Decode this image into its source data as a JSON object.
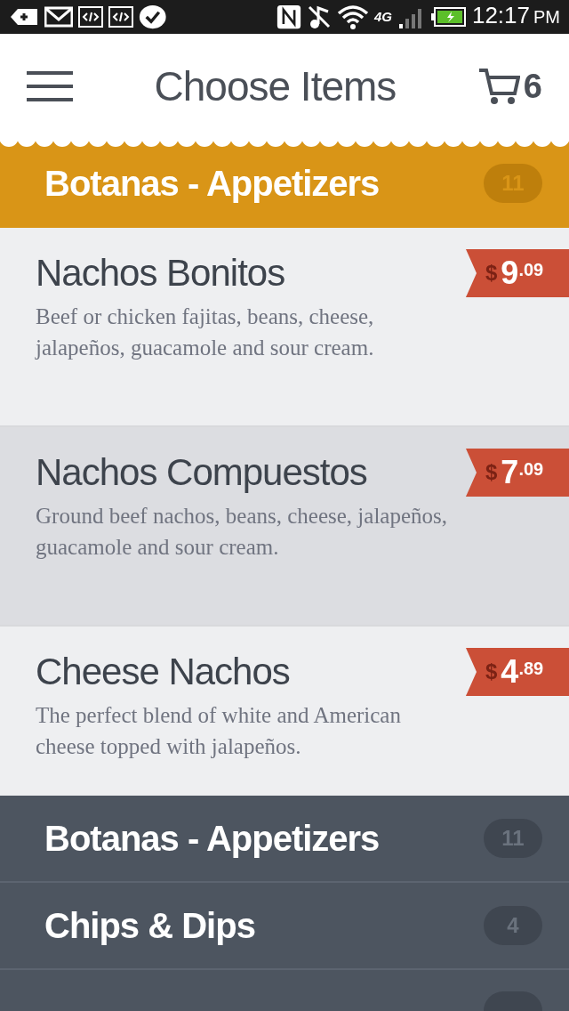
{
  "status_bar": {
    "time": "12:17",
    "ampm": "PM",
    "network": "4G"
  },
  "header": {
    "title": "Choose Items",
    "cart_count": "6"
  },
  "category": {
    "name": "Botanas - Appetizers",
    "count": "11"
  },
  "items": [
    {
      "name": "Nachos Bonitos",
      "description": "Beef or chicken fajitas, beans, cheese, jalapeños, guacamole and sour cream.",
      "currency": "$",
      "price_whole": "9",
      "price_cents": ".09",
      "selected": false
    },
    {
      "name": "Nachos Compuestos",
      "description": "Ground beef nachos, beans, cheese, jalapeños, guacamole and sour cream.",
      "currency": "$",
      "price_whole": "7",
      "price_cents": ".09",
      "selected": true
    },
    {
      "name": "Cheese Nachos",
      "description": "The perfect blend of white and American cheese topped with jalapeños.",
      "currency": "$",
      "price_whole": "4",
      "price_cents": ".89",
      "selected": false
    }
  ],
  "category_list": [
    {
      "name": "Botanas - Appetizers",
      "count": "11"
    },
    {
      "name": "Chips & Dips",
      "count": "4"
    }
  ]
}
